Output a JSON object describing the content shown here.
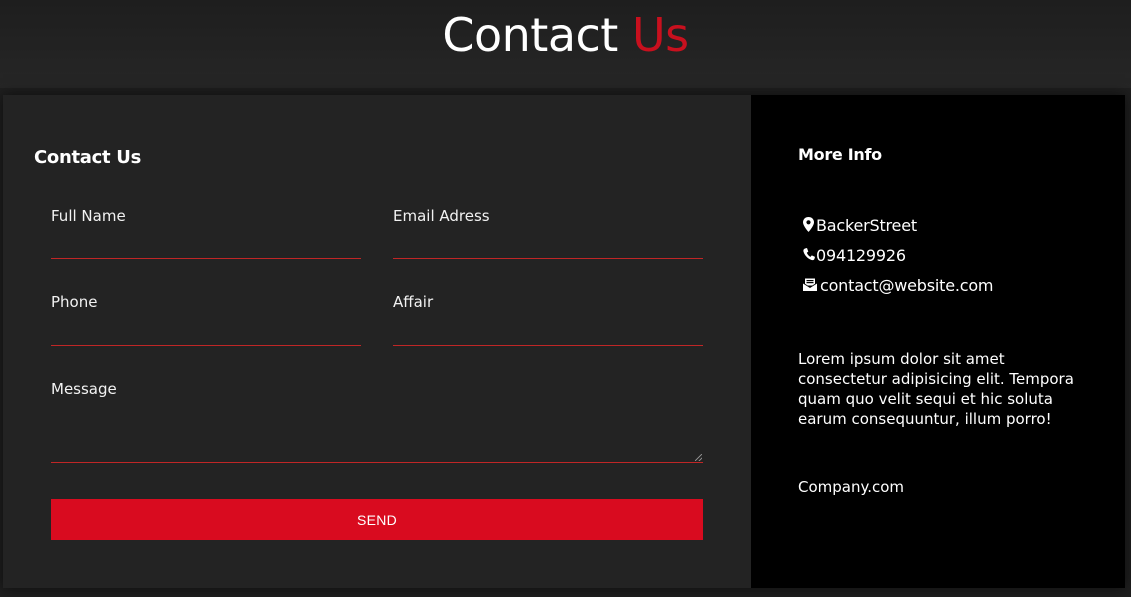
{
  "header": {
    "title_main": "Contact",
    "title_accent": "Us"
  },
  "form": {
    "heading": "Contact Us",
    "fields": {
      "full_name": {
        "label": "Full Name",
        "value": ""
      },
      "email": {
        "label": "Email Adress",
        "value": ""
      },
      "phone": {
        "label": "Phone",
        "value": ""
      },
      "affair": {
        "label": "Affair",
        "value": ""
      },
      "message": {
        "label": "Message",
        "value": ""
      }
    },
    "send_label": "SEND"
  },
  "info": {
    "heading": "More Info",
    "items": [
      {
        "icon": "location-pin-icon",
        "text": "BackerStreet"
      },
      {
        "icon": "phone-icon",
        "text": "094129926"
      },
      {
        "icon": "mail-icon",
        "text": "contact@website.com"
      }
    ],
    "description": "Lorem ipsum dolor sit amet consectetur adipisicing elit. Tempora quam quo velit sequi et hic soluta earum consequuntur, illum porro!",
    "company": "Company.com"
  },
  "colors": {
    "accent": "#c8101e",
    "button": "#d90b1f",
    "form_bg": "#232323",
    "info_bg": "#000000",
    "page_bg": "#1f1f1f",
    "underline": "#c02626"
  }
}
